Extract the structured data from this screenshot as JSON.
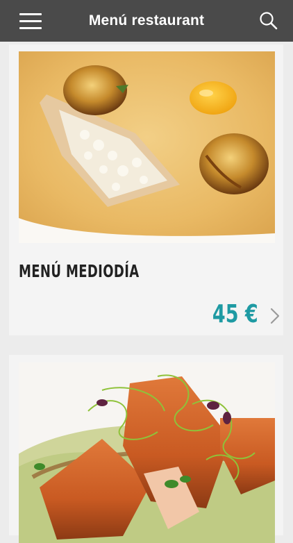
{
  "header": {
    "title": "Menú restaurant",
    "menu_icon": "hamburger-menu-icon",
    "search_icon": "search-icon",
    "bg_color": "#4a4a4a"
  },
  "cards": [
    {
      "title": "MENÚ MEDIODÍA",
      "price": "45 €",
      "price_color": "#1e9aa3",
      "image": "soup-with-onions-photo"
    },
    {
      "image": "seared-fish-with-sprouts-photo"
    }
  ]
}
